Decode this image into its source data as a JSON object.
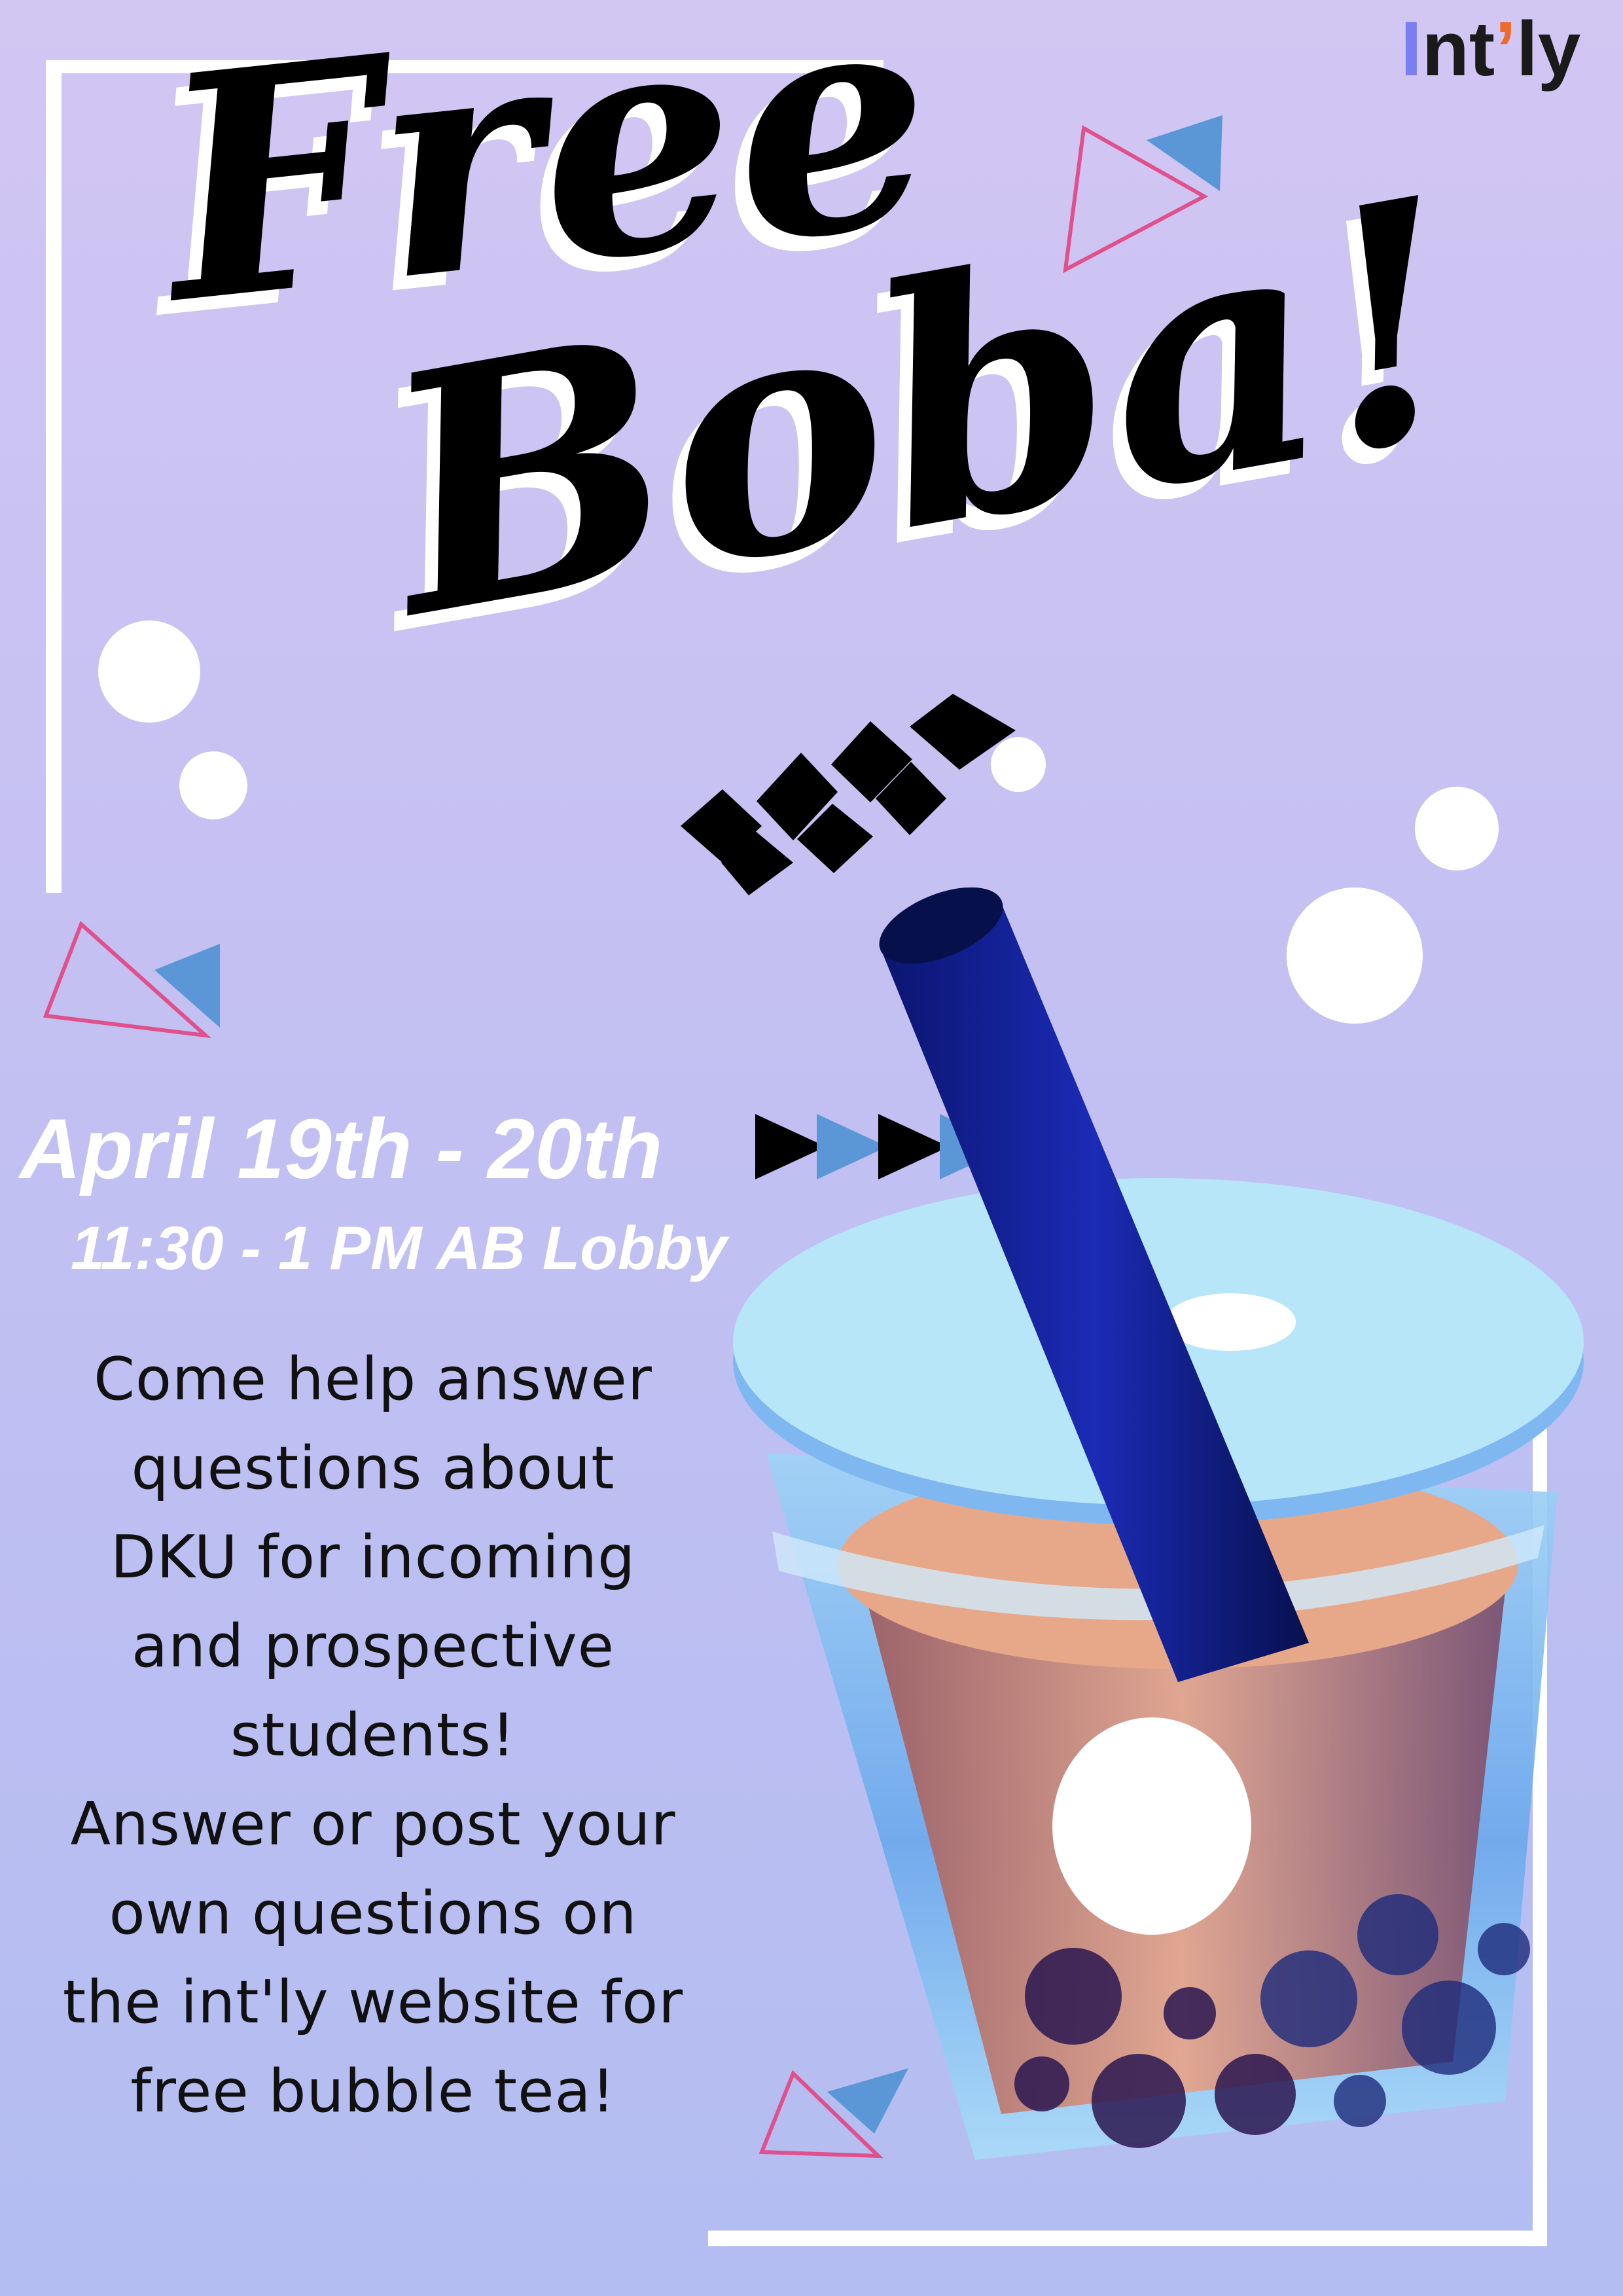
{
  "logo": {
    "prefix": "I",
    "middle": "nt",
    "apostrophe": "’",
    "suffix": "ly"
  },
  "title": {
    "line1": "Free",
    "line2": "Boba!"
  },
  "event": {
    "date": "April 19th - 20th",
    "time_location": "11:30 - 1 PM  AB Lobby"
  },
  "description": {
    "lines": [
      "Come help answer",
      "questions about",
      "DKU for incoming",
      "and prospective",
      "students!",
      "Answer or post your",
      "own questions on",
      "the int'ly website for",
      "free bubble tea!"
    ]
  },
  "colors": {
    "background_top": "#d2c6f3",
    "background_bottom": "#b3bdf1",
    "frame": "#ffffff",
    "accent_blue": "#5b97d6",
    "accent_pink": "#e0508c",
    "straw": "#0f1a8a",
    "cup_lid": "#aee1f7",
    "cup_body": "#7cb6ee",
    "tea": "#e8a58c",
    "pearl": "#2a1a5a"
  },
  "icons": [
    "logo-mark",
    "boba-cup-illustration",
    "triangle-decoration",
    "arrow-chevron",
    "bubble-circle",
    "checker-decoration"
  ]
}
